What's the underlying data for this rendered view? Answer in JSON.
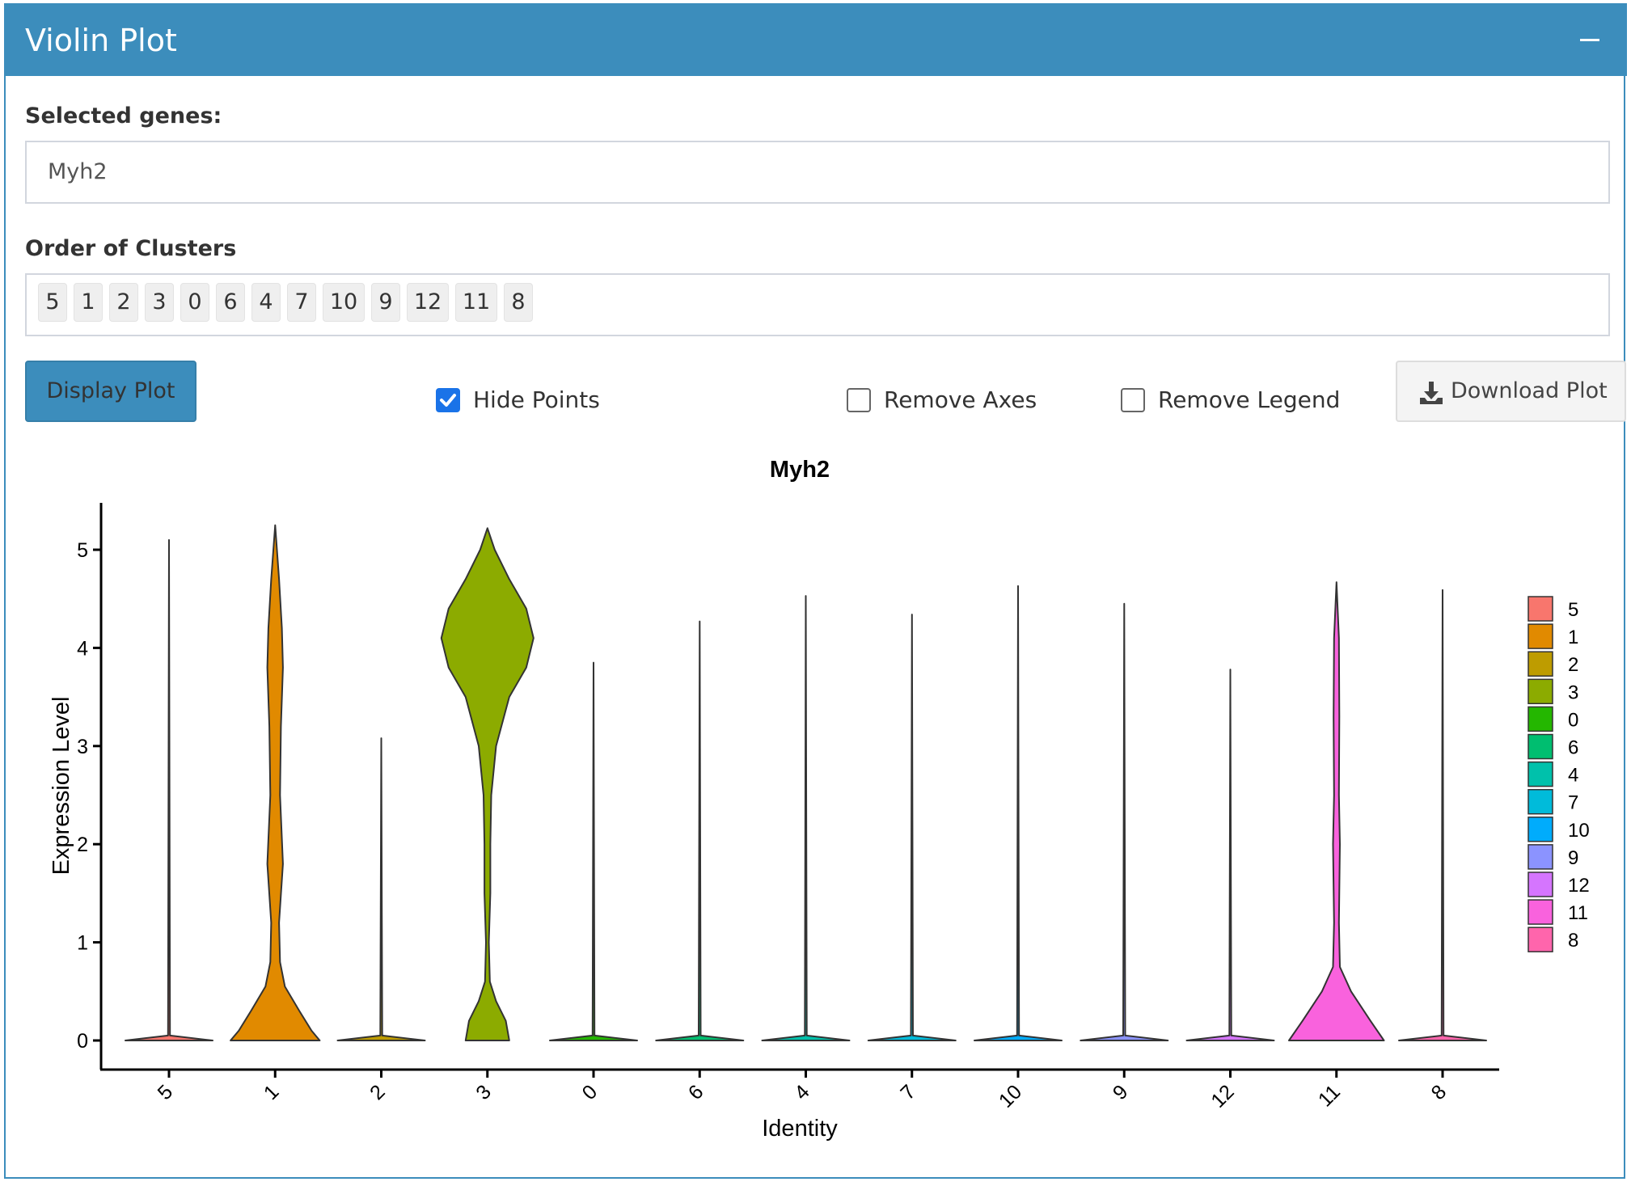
{
  "panel": {
    "title": "Violin Plot",
    "header_color": "#3c8dbc"
  },
  "genes": {
    "label": "Selected genes:",
    "value": "Myh2"
  },
  "clusters": {
    "label": "Order of Clusters",
    "order": [
      "5",
      "1",
      "2",
      "3",
      "0",
      "6",
      "4",
      "7",
      "10",
      "9",
      "12",
      "11",
      "8"
    ]
  },
  "controls": {
    "display_button": "Display Plot",
    "hide_points": {
      "label": "Hide Points",
      "checked": true
    },
    "remove_axes": {
      "label": "Remove Axes",
      "checked": false
    },
    "remove_legend": {
      "label": "Remove Legend",
      "checked": false
    },
    "download_button": "Download Plot"
  },
  "chart_data": {
    "type": "violin",
    "title": "Myh2",
    "xlabel": "Identity",
    "ylabel": "Expression Level",
    "ylim": [
      0,
      5.5
    ],
    "yticks": [
      0,
      1,
      2,
      3,
      4,
      5
    ],
    "legend_position": "right",
    "categories": [
      "5",
      "1",
      "2",
      "3",
      "0",
      "6",
      "4",
      "7",
      "10",
      "9",
      "12",
      "11",
      "8"
    ],
    "colors": [
      "#F8766D",
      "#E18A00",
      "#BE9C00",
      "#8CAB00",
      "#24B700",
      "#00BE70",
      "#00C1AB",
      "#00BBDA",
      "#00ACFC",
      "#8B93FF",
      "#D575FE",
      "#F962DD",
      "#FF65AC"
    ],
    "max_values": [
      5.1,
      5.25,
      3.08,
      5.22,
      3.85,
      4.27,
      4.53,
      4.34,
      4.63,
      4.45,
      3.78,
      4.67,
      4.59
    ],
    "density_profiles": [
      [
        [
          0,
          0.9
        ],
        [
          0.05,
          0.02
        ],
        [
          5.1,
          0
        ]
      ],
      [
        [
          0,
          0.92
        ],
        [
          0.1,
          0.75
        ],
        [
          0.3,
          0.5
        ],
        [
          0.55,
          0.2
        ],
        [
          0.8,
          0.1
        ],
        [
          1.2,
          0.08
        ],
        [
          1.8,
          0.16
        ],
        [
          2.5,
          0.1
        ],
        [
          3.2,
          0.12
        ],
        [
          3.8,
          0.16
        ],
        [
          4.2,
          0.14
        ],
        [
          4.7,
          0.08
        ],
        [
          5.25,
          0
        ]
      ],
      [
        [
          0,
          0.9
        ],
        [
          0.05,
          0.02
        ],
        [
          3.08,
          0
        ]
      ],
      [
        [
          0,
          0.45
        ],
        [
          0.2,
          0.38
        ],
        [
          0.4,
          0.18
        ],
        [
          0.6,
          0.05
        ],
        [
          1.0,
          0.03
        ],
        [
          1.5,
          0.06
        ],
        [
          2.0,
          0.06
        ],
        [
          2.5,
          0.08
        ],
        [
          3.0,
          0.18
        ],
        [
          3.5,
          0.45
        ],
        [
          3.8,
          0.8
        ],
        [
          4.1,
          0.95
        ],
        [
          4.4,
          0.8
        ],
        [
          4.7,
          0.45
        ],
        [
          5.0,
          0.15
        ],
        [
          5.22,
          0
        ]
      ],
      [
        [
          0,
          0.9
        ],
        [
          0.05,
          0.02
        ],
        [
          3.85,
          0
        ]
      ],
      [
        [
          0,
          0.9
        ],
        [
          0.05,
          0.02
        ],
        [
          4.27,
          0
        ]
      ],
      [
        [
          0,
          0.9
        ],
        [
          0.05,
          0.02
        ],
        [
          4.53,
          0
        ]
      ],
      [
        [
          0,
          0.9
        ],
        [
          0.05,
          0.02
        ],
        [
          4.34,
          0
        ]
      ],
      [
        [
          0,
          0.9
        ],
        [
          0.05,
          0.02
        ],
        [
          4.63,
          0
        ]
      ],
      [
        [
          0,
          0.9
        ],
        [
          0.05,
          0.02
        ],
        [
          4.45,
          0
        ]
      ],
      [
        [
          0,
          0.9
        ],
        [
          0.05,
          0.02
        ],
        [
          3.78,
          0
        ]
      ],
      [
        [
          0,
          0.98
        ],
        [
          0.2,
          0.7
        ],
        [
          0.5,
          0.3
        ],
        [
          0.75,
          0.07
        ],
        [
          1.2,
          0.05
        ],
        [
          2.0,
          0.07
        ],
        [
          2.5,
          0.05
        ],
        [
          3.3,
          0.06
        ],
        [
          4.1,
          0.05
        ],
        [
          4.67,
          0
        ]
      ],
      [
        [
          0,
          0.9
        ],
        [
          0.05,
          0.02
        ],
        [
          4.59,
          0
        ]
      ]
    ]
  }
}
